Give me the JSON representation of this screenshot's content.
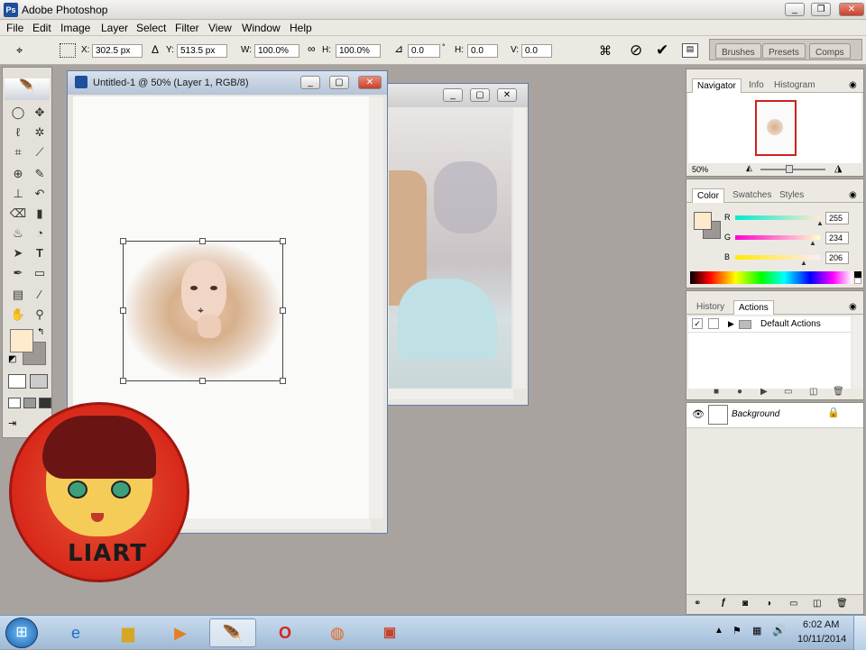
{
  "app": {
    "title": "Adobe Photoshop"
  },
  "menu": [
    "File",
    "Edit",
    "Image",
    "Layer",
    "Select",
    "Filter",
    "View",
    "Window",
    "Help"
  ],
  "options": {
    "x_label": "X:",
    "x_value": "302.5 px",
    "y_label": "Y:",
    "y_value": "513.5 px",
    "w_label": "W:",
    "w_value": "100.0%",
    "h_label": "H:",
    "h_value": "100.0%",
    "angle_value": "0.0",
    "skew_h_label": "H:",
    "skew_h_value": "0.0",
    "skew_v_label": "V:",
    "skew_v_value": "0.0",
    "well_tabs": [
      "Brushes",
      "Presets",
      "Comps"
    ]
  },
  "document": {
    "title": "Untitled-1 @ 50% (Layer 1, RGB/8)"
  },
  "navigator": {
    "tabs": [
      "Navigator",
      "Info",
      "Histogram"
    ],
    "zoom": "50%"
  },
  "color": {
    "tabs": [
      "Color",
      "Swatches",
      "Styles"
    ],
    "r_label": "R",
    "r_value": "255",
    "g_label": "G",
    "g_value": "234",
    "b_label": "B",
    "b_value": "206",
    "fg_color": "#ffeace"
  },
  "actions": {
    "tabs": [
      "History",
      "Actions"
    ],
    "item": "Default Actions"
  },
  "layers": {
    "background_name": "Background"
  },
  "logo": {
    "text": "LIART"
  },
  "taskbar": {
    "time": "6:02 AM",
    "date": "10/11/2014"
  }
}
